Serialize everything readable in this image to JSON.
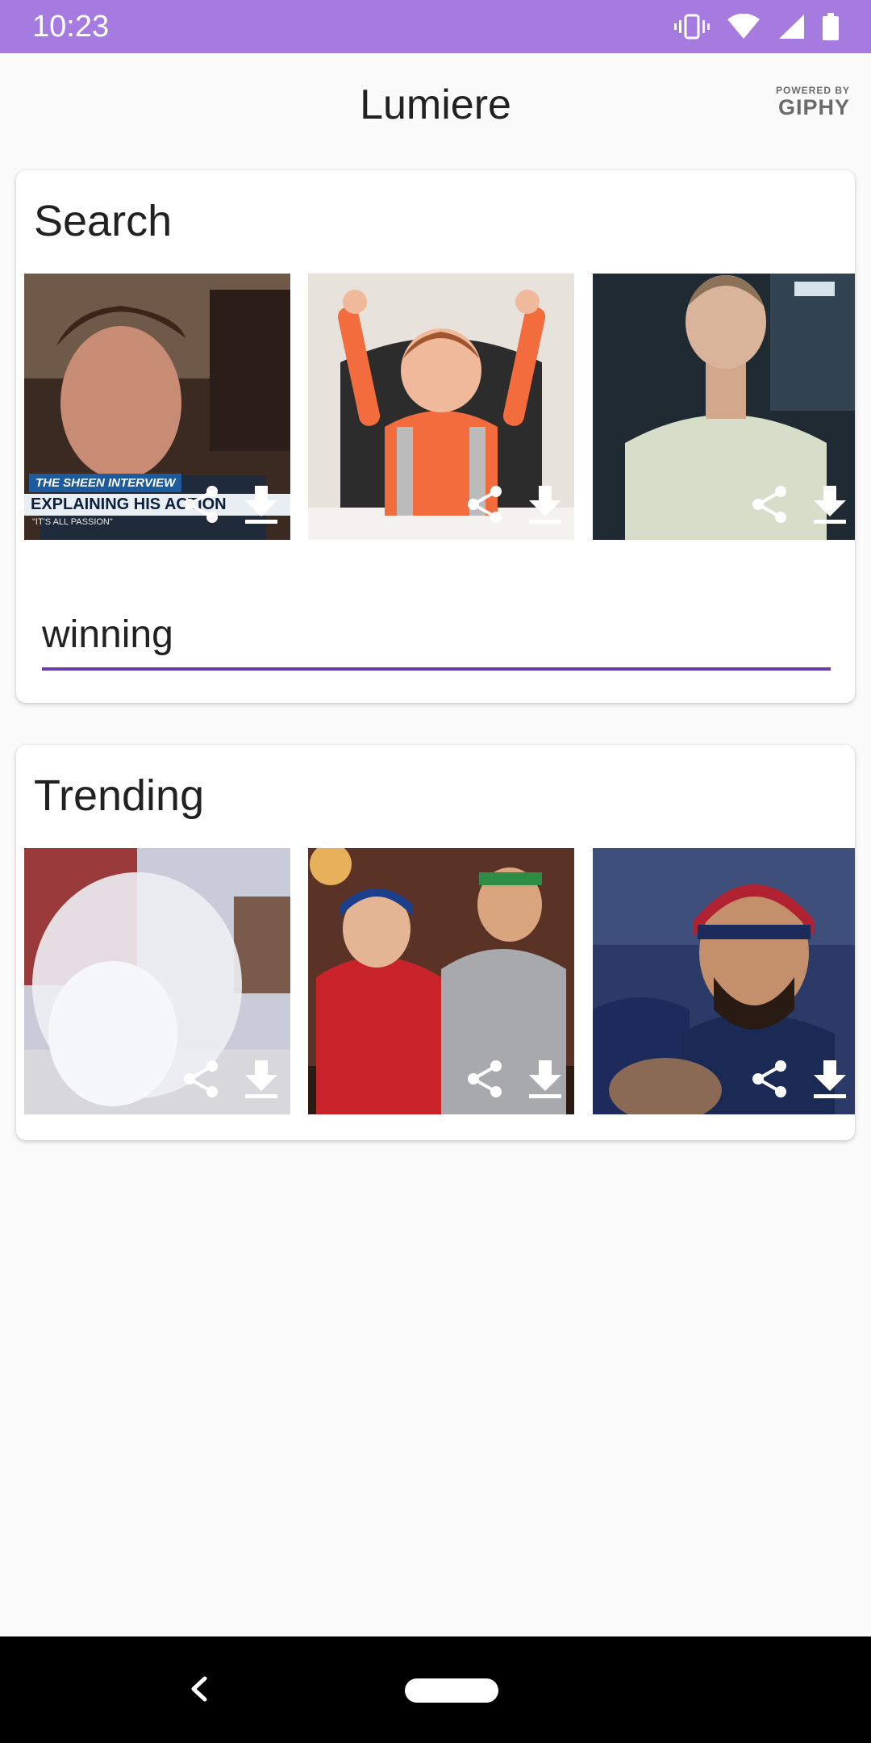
{
  "status": {
    "time": "10:23"
  },
  "app": {
    "title": "Lumiere",
    "giphy_powered": "POWERED BY",
    "giphy_brand": "GIPHY"
  },
  "search": {
    "title": "Search",
    "query": "winning",
    "gifs": [
      {
        "caption": {
          "line1": "THE SHEEN INTERVIEW",
          "line2": "EXPLAINING HIS ACTION",
          "line3": "\"IT'S ALL PASSION\""
        }
      },
      {},
      {}
    ]
  },
  "trending": {
    "title": "Trending"
  },
  "icons": {
    "share": "share-icon",
    "download": "download-icon"
  },
  "colors": {
    "status_bar": "#a57be0",
    "accent": "#6a3ea6"
  }
}
